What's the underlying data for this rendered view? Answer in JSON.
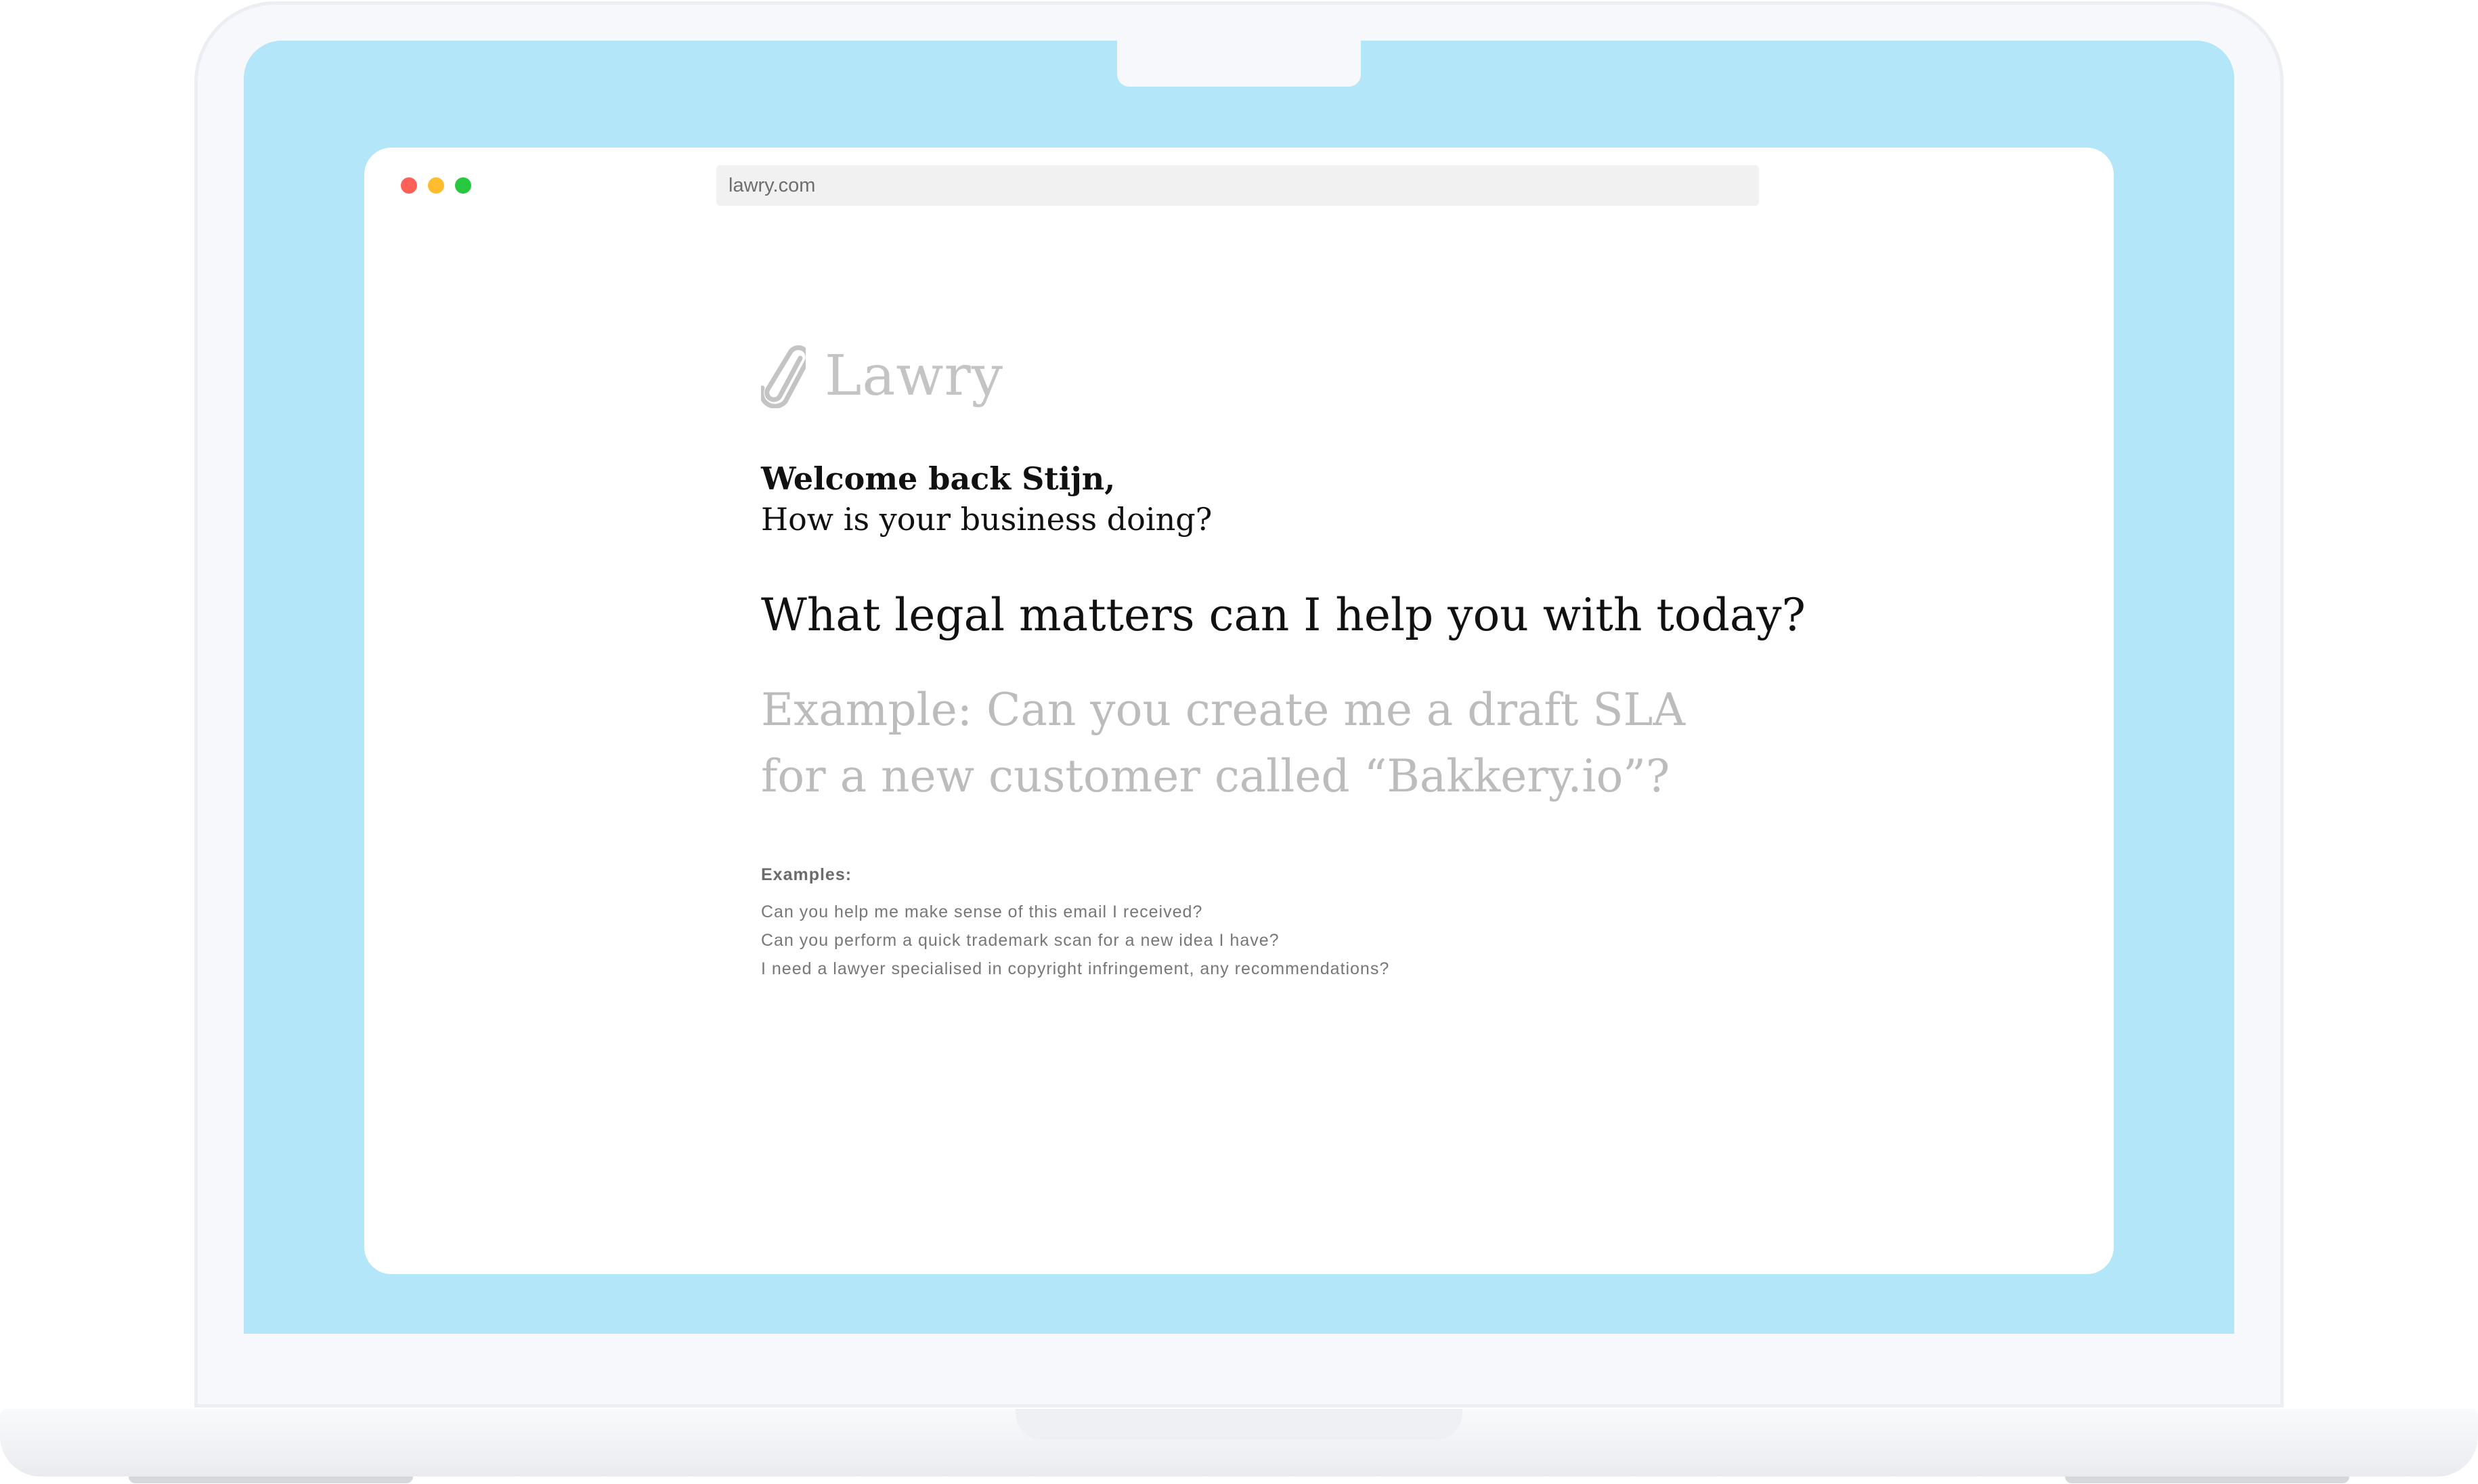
{
  "browser": {
    "url": "lawry.com",
    "traffic_lights": {
      "close": "#fe5f57",
      "minimize": "#febc2e",
      "maximize": "#28c840"
    }
  },
  "brand": {
    "name": "Lawry",
    "logo_icon": "paperclip-icon",
    "color": "#c4c4c4"
  },
  "greeting": {
    "title": "Welcome back Stijn,",
    "subtitle": "How is your business doing?"
  },
  "main": {
    "question": "What legal matters can I help you with today?",
    "prompt_placeholder_lines": [
      "Example: Can you create me a draft SLA",
      "for a new customer called “Bakkery.io”?"
    ]
  },
  "examples": {
    "heading": "Examples:",
    "items": [
      "Can you help me make sense of this email I received?",
      "Can you perform a quick trademark scan for a new idea I have?",
      "I need a lawyer specialised in copyright infringement, any recommendations?"
    ]
  },
  "colors": {
    "screen_background": "#b3e6f8",
    "placeholder_text": "#bcbcbc"
  }
}
